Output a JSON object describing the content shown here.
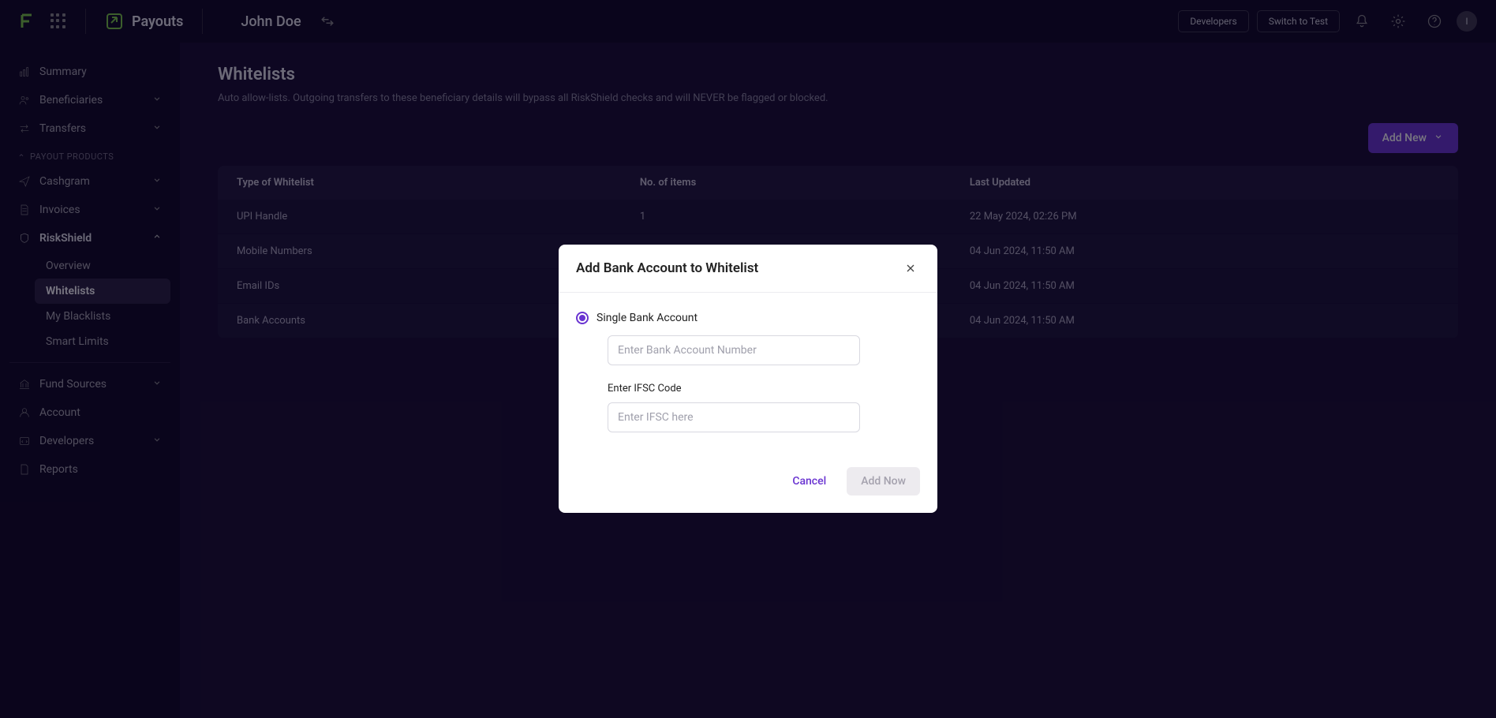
{
  "header": {
    "product_name": "Payouts",
    "user_name": "John Doe",
    "developers_btn": "Developers",
    "switch_test_btn": "Switch to Test",
    "avatar_initial": "I"
  },
  "sidebar": {
    "summary": "Summary",
    "beneficiaries": "Beneficiaries",
    "transfers": "Transfers",
    "section_payout_products": "PAYOUT PRODUCTS",
    "cashgram": "Cashgram",
    "invoices": "Invoices",
    "riskshield": "RiskShield",
    "riskshield_sub": {
      "overview": "Overview",
      "whitelists": "Whitelists",
      "my_blacklists": "My Blacklists",
      "smart_limits": "Smart Limits"
    },
    "fund_sources": "Fund Sources",
    "account": "Account",
    "developers": "Developers",
    "reports": "Reports"
  },
  "main": {
    "page_title": "Whitelists",
    "page_subtitle": "Auto allow-lists. Outgoing transfers to these beneficiary details will bypass all RiskShield checks and will NEVER be flagged or blocked.",
    "add_new_btn": "Add New",
    "table": {
      "columns": [
        "Type of Whitelist",
        "No. of items",
        "Last Updated"
      ],
      "rows": [
        {
          "type": "UPI Handle",
          "count": "1",
          "updated": "22 May 2024, 02:26 PM"
        },
        {
          "type": "Mobile Numbers",
          "count": "",
          "updated": "04 Jun 2024, 11:50 AM"
        },
        {
          "type": "Email IDs",
          "count": "",
          "updated": "04 Jun 2024, 11:50 AM"
        },
        {
          "type": "Bank Accounts",
          "count": "",
          "updated": "04 Jun 2024, 11:50 AM"
        }
      ]
    }
  },
  "modal": {
    "title": "Add Bank Account to Whitelist",
    "radio_single": "Single Bank Account",
    "account_placeholder": "Enter Bank Account Number",
    "ifsc_label": "Enter IFSC Code",
    "ifsc_placeholder": "Enter IFSC here",
    "cancel_btn": "Cancel",
    "add_now_btn": "Add Now"
  }
}
